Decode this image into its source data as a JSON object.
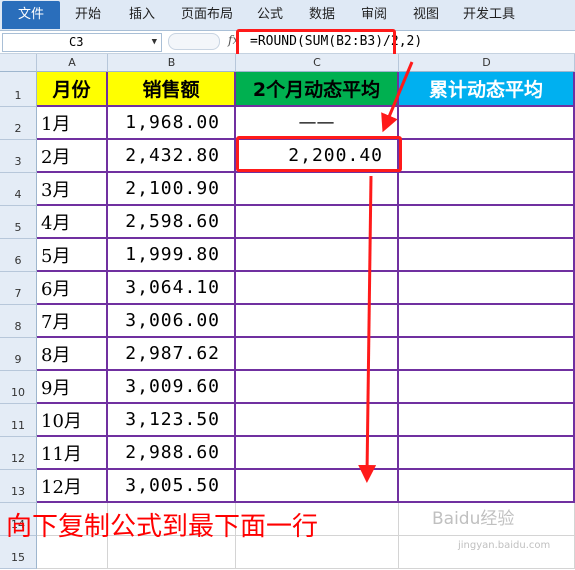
{
  "ribbon": {
    "tabs": [
      "文件",
      "开始",
      "插入",
      "页面布局",
      "公式",
      "数据",
      "审阅",
      "视图",
      "开发工具"
    ]
  },
  "formula_bar": {
    "name_box": "C3",
    "fx_label": "fx",
    "formula": "=ROUND(SUM(B2:B3)/2,2)"
  },
  "columns": [
    "A",
    "B",
    "C",
    "D"
  ],
  "row_numbers": [
    "1",
    "2",
    "3",
    "4",
    "5",
    "6",
    "7",
    "8",
    "9",
    "10",
    "11",
    "12",
    "13",
    "14",
    "15"
  ],
  "headers": {
    "a": "月份",
    "b": "销售额",
    "c": "2个月动态平均",
    "d": "累计动态平均"
  },
  "rows": [
    {
      "month": "1月",
      "sales": "1,968.00",
      "c": "——"
    },
    {
      "month": "2月",
      "sales": "2,432.80",
      "c": "2,200.40"
    },
    {
      "month": "3月",
      "sales": "2,100.90",
      "c": ""
    },
    {
      "month": "4月",
      "sales": "2,598.60",
      "c": ""
    },
    {
      "month": "5月",
      "sales": "1,999.80",
      "c": ""
    },
    {
      "month": "6月",
      "sales": "3,064.10",
      "c": ""
    },
    {
      "month": "7月",
      "sales": "3,006.00",
      "c": ""
    },
    {
      "month": "8月",
      "sales": "2,987.62",
      "c": ""
    },
    {
      "month": "9月",
      "sales": "3,009.60",
      "c": ""
    },
    {
      "month": "10月",
      "sales": "3,123.50",
      "c": ""
    },
    {
      "month": "11月",
      "sales": "2,988.60",
      "c": ""
    },
    {
      "month": "12月",
      "sales": "3,005.50",
      "c": ""
    }
  ],
  "caption": "向下复制公式到最下面一行",
  "watermark": "Baidu经验",
  "watermark_sub": "jingyan.baidu.com",
  "colors": {
    "header_yellow": "#ffff00",
    "header_green": "#00b050",
    "header_blue": "#00b0f0",
    "border_purple": "#7030a0",
    "annotation_red": "#ff1a1a"
  }
}
